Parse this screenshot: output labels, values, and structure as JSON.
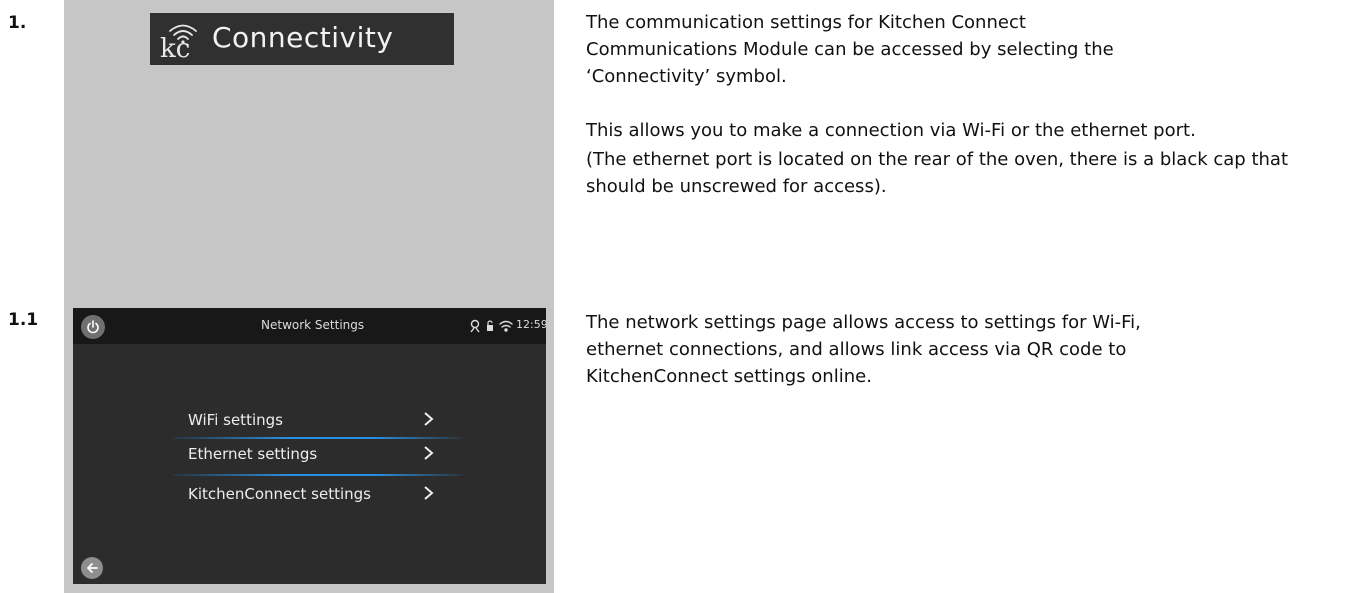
{
  "steps": [
    {
      "number": "1.",
      "image": {
        "logo_text": "kc",
        "label": "Connectivity"
      },
      "paragraphs": [
        "The communication settings for Kitchen Connect Communications Module can be accessed by selecting the ‘Connectivity’ symbol.",
        "This allows you to make a connection via Wi-Fi or the ethernet port.",
        "(The ethernet port is located on the rear of the oven, there is a black cap that should be unscrewed for access)."
      ]
    },
    {
      "number": "1.1",
      "screen": {
        "title": "Network Settings",
        "time": "12:59",
        "icons": [
          "power-icon",
          "chef-icon",
          "lock-icon",
          "wifi-icon",
          "back-arrow-icon",
          "chevron-right-icon"
        ],
        "menu": [
          {
            "label": "WiFi settings"
          },
          {
            "label": "Ethernet settings"
          },
          {
            "label": "KitchenConnect settings"
          }
        ]
      },
      "paragraphs": [
        "The network settings page allows access to settings for Wi-Fi, ethernet connections, and allows link access via QR code to KitchenConnect settings online."
      ]
    }
  ],
  "colors": {
    "panel_bg": "#c6c6c6",
    "screen_bg": "#2c2c2c",
    "accent_divider": "#2a8fe0"
  }
}
